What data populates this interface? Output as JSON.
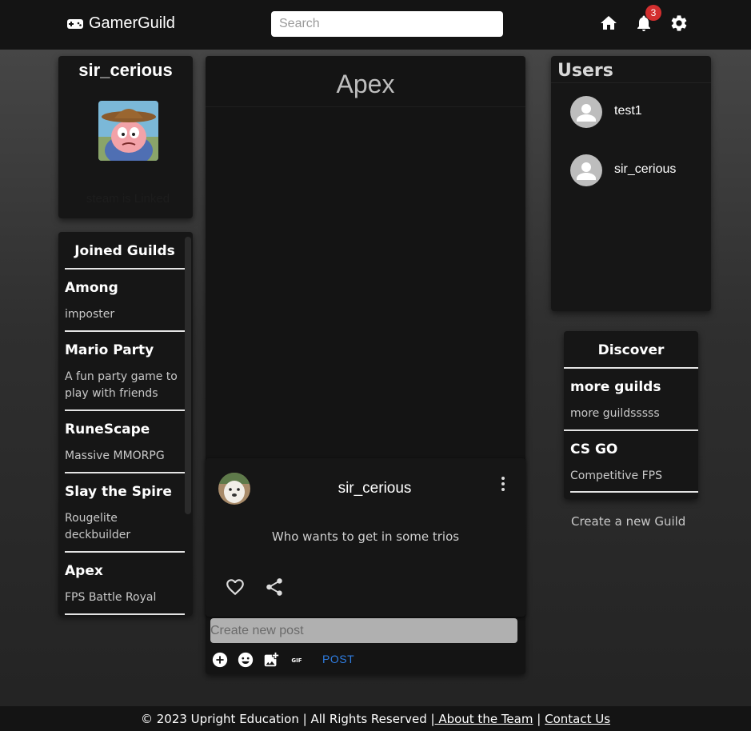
{
  "header": {
    "brand": "GamerGuild",
    "search_placeholder": "Search",
    "notification_count": "3"
  },
  "profile": {
    "username": "sir_cerious",
    "status": "steam is Linked"
  },
  "joined_guilds": {
    "title": "Joined Guilds",
    "items": [
      {
        "name": "Among",
        "desc": "imposter"
      },
      {
        "name": "Mario Party",
        "desc": "A fun party game to play with friends"
      },
      {
        "name": "RuneScape",
        "desc": "Massive MMORPG"
      },
      {
        "name": "Slay the Spire",
        "desc": "Rougelite deckbuilder"
      },
      {
        "name": "Apex",
        "desc": "FPS Battle Royal"
      }
    ]
  },
  "feed": {
    "title": "Apex",
    "post": {
      "author": "sir_cerious",
      "text": "Who wants to get in some trios"
    },
    "composer": {
      "placeholder": "Create new post",
      "gif_label": "GIF",
      "submit_label": "POST"
    }
  },
  "users": {
    "title": "Users",
    "items": [
      {
        "name": "test1"
      },
      {
        "name": "sir_cerious"
      }
    ]
  },
  "discover": {
    "title": "Discover",
    "items": [
      {
        "name": "more guilds",
        "desc": "more guildsssss"
      },
      {
        "name": "CS GO",
        "desc": "Competitive FPS"
      }
    ],
    "create_link": "Create a new Guild"
  },
  "footer": {
    "copyright": "© 2023 Upright Education | All Rights Reserved |",
    "about_link": " About the Team",
    "separator": "|",
    "contact_link": "Contact Us"
  },
  "colors": {
    "accent": "#2f7de1",
    "badge": "#d32f2f",
    "panel": "#161616"
  }
}
